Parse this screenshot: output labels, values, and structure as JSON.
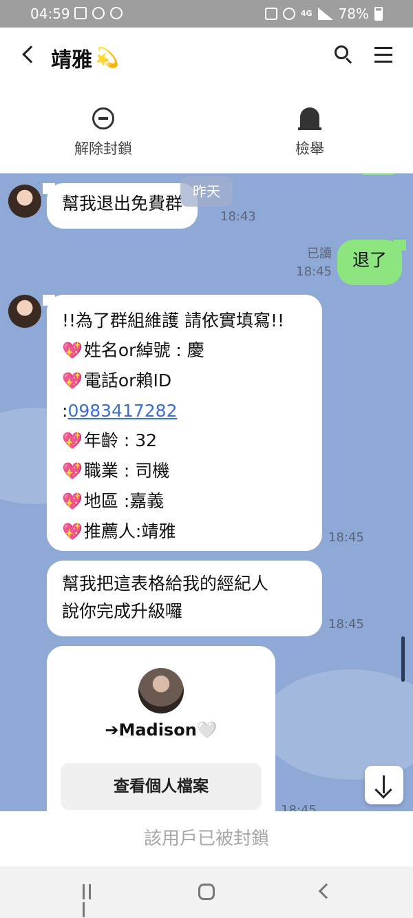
{
  "status_bar": {
    "time": "04:59",
    "network": "4G",
    "battery": "78%"
  },
  "header": {
    "title": "靖雅",
    "title_emoji": "💫"
  },
  "actions": {
    "unblock_label": "解除封鎖",
    "report_label": "檢舉"
  },
  "chat": {
    "date_pill": "昨天",
    "messages": [
      {
        "from": "contact",
        "text": "幫我退出免費群",
        "time": "18:43"
      },
      {
        "from": "me",
        "text": "退了",
        "read": "已讀",
        "time": "18:45"
      },
      {
        "from": "contact",
        "time": "18:45",
        "heading": "!!為了群組維護 請依實填寫!!",
        "fields": [
          {
            "emoji": "💖",
            "text": "姓名or綽號 : 慶"
          },
          {
            "emoji": "💖",
            "text": "電話or賴ID"
          },
          {
            "emoji": "",
            "prefix": ":",
            "link": "0983417282"
          },
          {
            "emoji": "💖",
            "text": "年齡 : 32"
          },
          {
            "emoji": "💖",
            "text": "職業 : 司機"
          },
          {
            "emoji": "💖",
            "text": "地區 :嘉義"
          },
          {
            "emoji": "💖",
            "text": "推薦人:靖雅"
          }
        ]
      },
      {
        "from": "contact",
        "time": "18:45",
        "lines": [
          "幫我把這表格給我的經紀人",
          "說你完成升級囉"
        ]
      },
      {
        "from": "contact",
        "type": "profile_card",
        "name": "➔Madison🤍",
        "button": "查看個人檔案",
        "time": "18:45"
      }
    ]
  },
  "blocked_notice": "該用戶已被封鎖",
  "colors": {
    "chat_bg": "#8fa9d6",
    "sent_bubble": "#8de57f",
    "link": "#3d6fd1"
  }
}
